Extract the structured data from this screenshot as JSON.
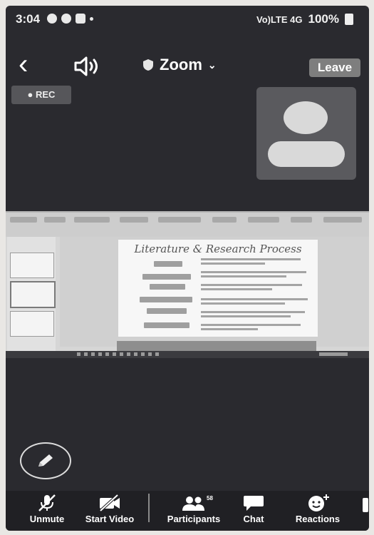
{
  "status_bar": {
    "time": "3:04",
    "signal": "Vo)LTE 4G",
    "battery": "100%"
  },
  "header": {
    "title": "Zoom",
    "leave_label": "Leave"
  },
  "recording": {
    "label": "● REC"
  },
  "shared_screen": {
    "slide_title": "Literature & Research Process"
  },
  "toolbar": {
    "unmute": "Unmute",
    "start_video": "Start Video",
    "participants": "Participants",
    "participants_count": "58",
    "chat": "Chat",
    "reactions": "Reactions"
  },
  "colors": {
    "meeting_bg": "#2a2a2f",
    "toolbar_bg": "#202024",
    "leave_bg": "#7e7e7e"
  }
}
